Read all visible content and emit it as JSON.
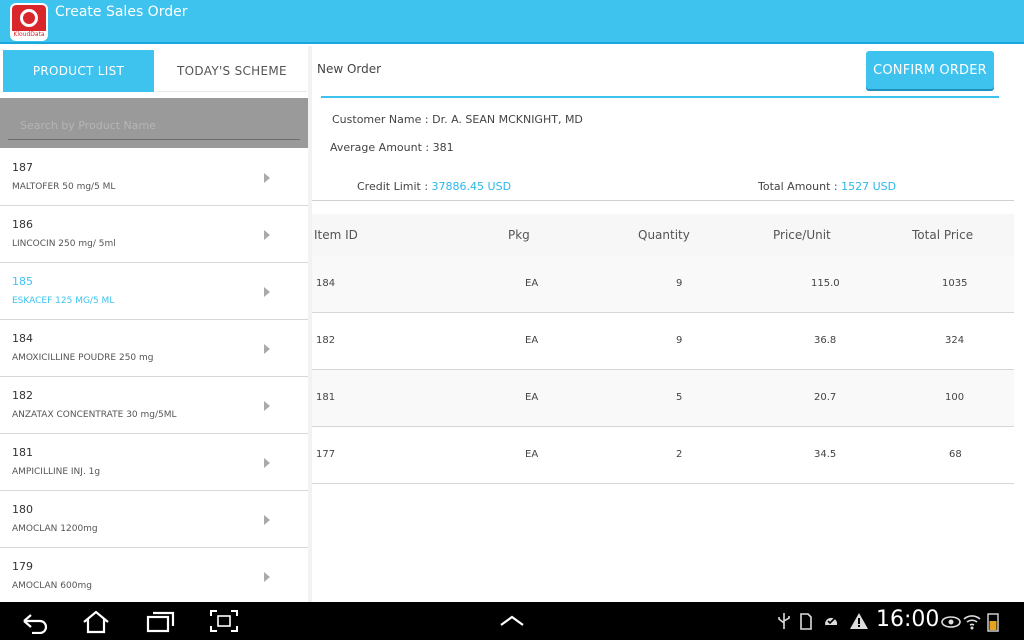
{
  "app": {
    "title": "Create Sales Order",
    "logo_text": "KloudData",
    "accent_color": "#3ec3ef"
  },
  "tabs": {
    "product_list": "PRODUCT LIST",
    "todays_scheme": "TODAY'S SCHEME"
  },
  "search": {
    "placeholder": "Search by Product Name"
  },
  "products": [
    {
      "id": "187",
      "name": "MALTOFER 50 mg/5 ML"
    },
    {
      "id": "186",
      "name": "LINCOCIN 250 mg/ 5ml"
    },
    {
      "id": "185",
      "name": "ESKACEF 125 MG/5 ML",
      "selected": true
    },
    {
      "id": "184",
      "name": "AMOXICILLINE POUDRE 250 mg"
    },
    {
      "id": "182",
      "name": "ANZATAX CONCENTRATE 30 mg/5ML"
    },
    {
      "id": "181",
      "name": "AMPICILLINE INJ. 1g"
    },
    {
      "id": "180",
      "name": "AMOCLAN 1200mg"
    },
    {
      "id": "179",
      "name": "AMOCLAN 600mg"
    }
  ],
  "order": {
    "heading": "New Order",
    "confirm_label": "CONFIRM ORDER",
    "customer_label": "Customer Name : ",
    "customer_value": "Dr. A. SEAN MCKNIGHT, MD",
    "average_label": "Average Amount : ",
    "average_value": "381",
    "credit_label": "Credit Limit : ",
    "credit_value": "37886.45 USD",
    "total_label": "Total Amount : ",
    "total_value": "1527 USD"
  },
  "table": {
    "headers": [
      "Item ID",
      "Pkg",
      "Quantity",
      "Price/Unit",
      "Total Price"
    ],
    "rows": [
      [
        "184",
        "EA",
        "9",
        "115.0",
        "1035"
      ],
      [
        "182",
        "EA",
        "9",
        "36.8",
        "324"
      ],
      [
        "181",
        "EA",
        "5",
        "20.7",
        "100"
      ],
      [
        "177",
        "EA",
        "2",
        "34.5",
        "68"
      ]
    ]
  },
  "system_bar": {
    "time": "16:00",
    "icons": [
      "back-icon",
      "home-icon",
      "recent-apps-icon",
      "screenshot-icon",
      "chevron-up-icon",
      "usb-icon",
      "sd-card-icon",
      "sync-icon",
      "warning-icon",
      "visibility-icon",
      "wifi-icon",
      "battery-icon"
    ]
  }
}
